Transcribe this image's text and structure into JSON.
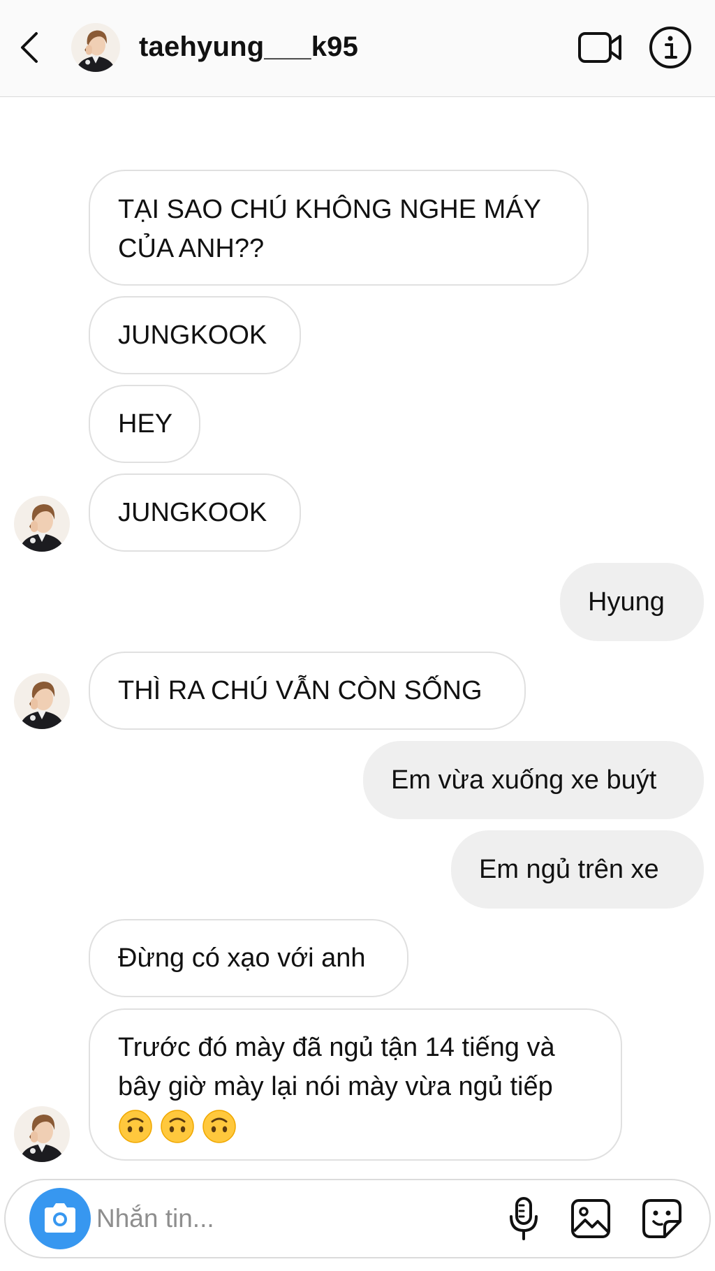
{
  "header": {
    "username": "taehyung___k95",
    "back_icon": "chevron-left-icon",
    "video_icon": "video-call-icon",
    "info_icon": "info-icon"
  },
  "messages": [
    {
      "sender": "other",
      "lines": [
        "TẠI SAO CHÚ KHÔNG NGHE MÁY",
        "CỦA ANH??"
      ]
    },
    {
      "sender": "other",
      "lines": [
        "JUNGKOOK"
      ]
    },
    {
      "sender": "other",
      "lines": [
        "HEY"
      ]
    },
    {
      "sender": "other",
      "lines": [
        "JUNGKOOK"
      ]
    },
    {
      "sender": "me",
      "lines": [
        "Hyung"
      ]
    },
    {
      "sender": "other",
      "lines": [
        "THÌ RA CHÚ VẪN CÒN SỐNG"
      ]
    },
    {
      "sender": "me",
      "lines": [
        "Em vừa xuống xe buýt"
      ]
    },
    {
      "sender": "me",
      "lines": [
        "Em ngủ trên xe"
      ]
    },
    {
      "sender": "other",
      "lines": [
        "Đừng có xạo với anh"
      ]
    },
    {
      "sender": "other",
      "lines": [
        "Trước đó mày đã ngủ tận 14 tiếng và",
        "bây giờ mày lại nói mày vừa ngủ tiếp"
      ],
      "emoji": [
        "upside-down-face",
        "upside-down-face",
        "upside-down-face"
      ]
    }
  ],
  "composer": {
    "placeholder": "Nhắn tin...",
    "camera_icon": "camera-icon",
    "mic_icon": "microphone-icon",
    "photo_icon": "photo-icon",
    "sticker_icon": "sticker-icon"
  },
  "colors": {
    "accent_blue": "#3797f0",
    "outgoing_bubble": "#efefef",
    "incoming_border": "#e0e0e0",
    "emoji_yellow": "#ffc83d"
  }
}
